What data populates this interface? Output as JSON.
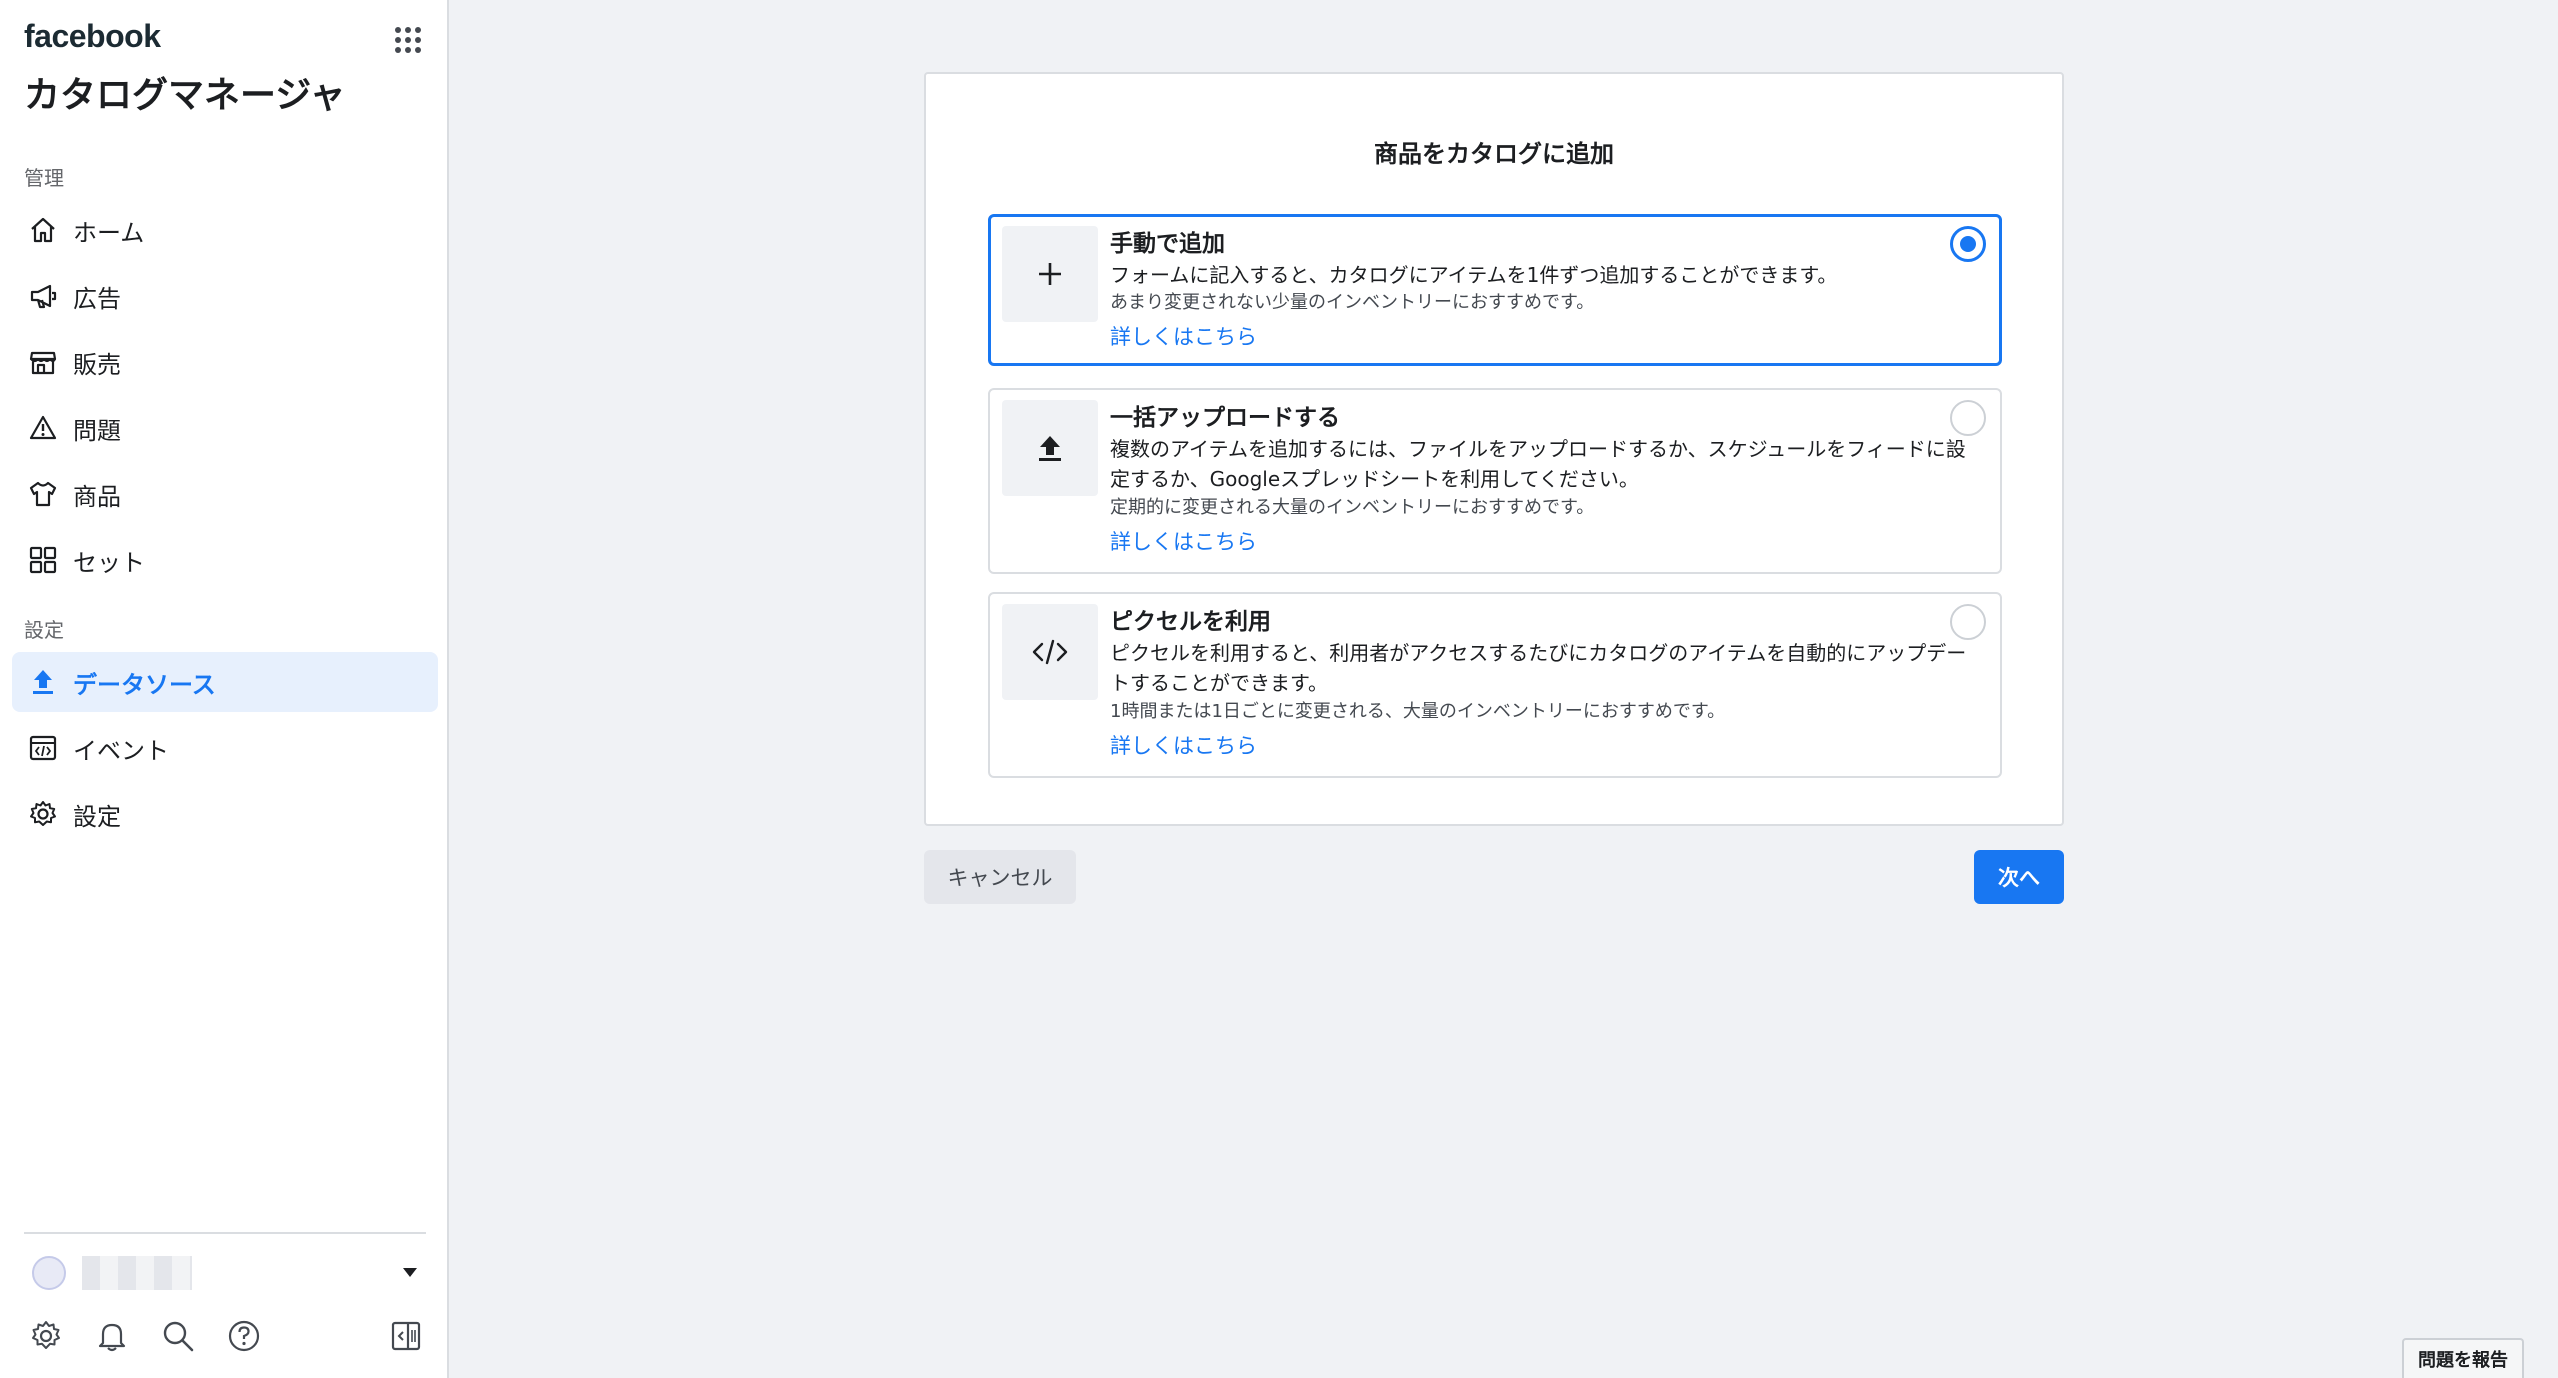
{
  "brand": {
    "logo": "facebook",
    "app_title": "カタログマネージャ"
  },
  "sidebar": {
    "section_manage": "管理",
    "manage_items": [
      {
        "label": "ホーム",
        "icon": "home-icon"
      },
      {
        "label": "広告",
        "icon": "megaphone-icon"
      },
      {
        "label": "販売",
        "icon": "store-icon"
      },
      {
        "label": "問題",
        "icon": "warning-icon"
      },
      {
        "label": "商品",
        "icon": "shirt-icon"
      },
      {
        "label": "セット",
        "icon": "grid-icon"
      }
    ],
    "section_settings": "設定",
    "settings_items": [
      {
        "label": "データソース",
        "icon": "upload-icon",
        "active": true
      },
      {
        "label": "イベント",
        "icon": "code-window-icon"
      },
      {
        "label": "設定",
        "icon": "gear-icon"
      }
    ],
    "bottom_icons": [
      "settings-icon",
      "bell-icon",
      "search-icon",
      "help-icon",
      "panel-toggle-icon"
    ]
  },
  "dialog": {
    "title": "商品をカタログに追加",
    "options": [
      {
        "title": "手動で追加",
        "description": "フォームに記入すると、カタログにアイテムを1件ずつ追加することができます。",
        "sub": "あまり変更されない少量のインベントリーにおすすめです。",
        "link": "詳しくはこちら",
        "icon": "plus-icon",
        "selected": true
      },
      {
        "title": "一括アップロードする",
        "description": "複数のアイテムを追加するには、ファイルをアップロードするか、スケジュールをフィードに設定するか、Googleスプレッドシートを利用してください。",
        "sub": "定期的に変更される大量のインベントリーにおすすめです。",
        "link": "詳しくはこちら",
        "icon": "upload-icon",
        "selected": false
      },
      {
        "title": "ピクセルを利用",
        "description": "ピクセルを利用すると、利用者がアクセスするたびにカタログのアイテムを自動的にアップデートすることができます。",
        "sub": "1時間または1日ごとに変更される、大量のインベントリーにおすすめです。",
        "link": "詳しくはこちら",
        "icon": "code-icon",
        "selected": false
      }
    ]
  },
  "buttons": {
    "cancel": "キャンセル",
    "next": "次へ"
  },
  "report": "問題を報告",
  "colors": {
    "accent": "#1877f2",
    "background": "#f0f2f5"
  }
}
